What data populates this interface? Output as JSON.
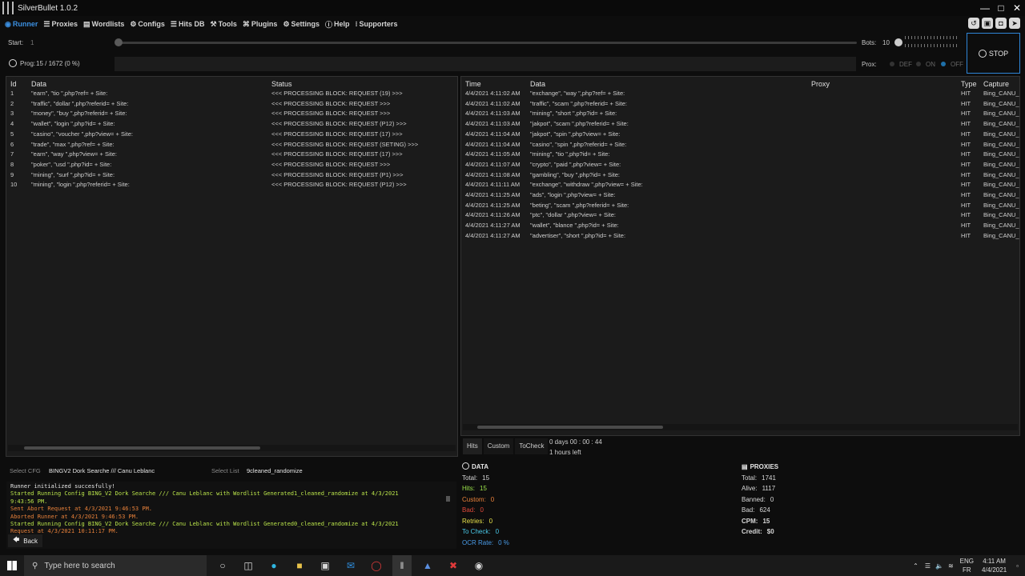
{
  "window": {
    "title": "SilverBullet 1.0.2"
  },
  "nav": {
    "items": [
      {
        "label": "Runner",
        "icon": "runner-icon",
        "active": true
      },
      {
        "label": "Proxies",
        "icon": "list-icon"
      },
      {
        "label": "Wordlists",
        "icon": "book-icon"
      },
      {
        "label": "Configs",
        "icon": "gear-icon"
      },
      {
        "label": "Hits DB",
        "icon": "database-icon"
      },
      {
        "label": "Tools",
        "icon": "tools-icon"
      },
      {
        "label": "Plugins",
        "icon": "plug-icon"
      },
      {
        "label": "Settings",
        "icon": "settings-icon"
      },
      {
        "label": "Help",
        "icon": "help-icon"
      },
      {
        "label": "Supporters",
        "icon": "more-icon"
      }
    ]
  },
  "runner": {
    "start_label": "Start:",
    "start_value": "1",
    "bots_label": "Bots:",
    "bots_value": "10",
    "prog_label": "Prog:",
    "prog_value": "15 / 1672 (0 %)",
    "prox_label": "Prox:",
    "prox_def": "DEF",
    "prox_on": "ON",
    "prox_off": "OFF",
    "stop_label": "STOP"
  },
  "left_table": {
    "headers": [
      "Id",
      "Data",
      "Status"
    ],
    "rows": [
      [
        "1",
        "\"earn\", \"tio \",php?ref= + Site:",
        "<<< PROCESSING BLOCK: REQUEST (19) >>>"
      ],
      [
        "2",
        "\"traffic\", \"dollar \",php?referid= + Site:",
        "<<< PROCESSING BLOCK: REQUEST >>>"
      ],
      [
        "3",
        "\"money\", \"buy \",php?referid= + Site:",
        "<<< PROCESSING BLOCK: REQUEST >>>"
      ],
      [
        "4",
        "\"wallet\", \"login \",php?id= + Site:",
        "<<< PROCESSING BLOCK: REQUEST (P12) >>>"
      ],
      [
        "5",
        "\"casino\", \"voucher \",php?view= + Site:",
        "<<< PROCESSING BLOCK: REQUEST (17) >>>"
      ],
      [
        "6",
        "\"trade\", \"max \",php?ref= + Site:",
        "<<< PROCESSING BLOCK: REQUEST (SETING) >>>"
      ],
      [
        "7",
        "\"earn\", \"way \",php?view= + Site:",
        "<<< PROCESSING BLOCK: REQUEST (17) >>>"
      ],
      [
        "8",
        "\"poker\", \"usd \",php?id= + Site:",
        "<<< PROCESSING BLOCK: REQUEST >>>"
      ],
      [
        "9",
        "\"mining\", \"surf \",php?id= + Site:",
        "<<< PROCESSING BLOCK: REQUEST (P1) >>>"
      ],
      [
        "10",
        "\"mining\", \"login \",php?referid= + Site:",
        "<<< PROCESSING BLOCK: REQUEST (P12) >>>"
      ]
    ]
  },
  "right_table": {
    "headers": [
      "Time",
      "Data",
      "Proxy",
      "Type",
      "Capture"
    ],
    "rows": [
      [
        "4/4/2021 4:11:02 AM",
        "\"exchange\", \"way \",php?ref= + Site:",
        "",
        "HIT",
        "Bing_CANU_"
      ],
      [
        "4/4/2021 4:11:02 AM",
        "\"traffic\", \"scam \",php?referid= + Site:",
        "",
        "HIT",
        "Bing_CANU_"
      ],
      [
        "4/4/2021 4:11:03 AM",
        "\"mining\", \"short \",php?id= + Site:",
        "",
        "HIT",
        "Bing_CANU_"
      ],
      [
        "4/4/2021 4:11:03 AM",
        "\"jakpot\", \"scam \",php?referid= + Site:",
        "",
        "HIT",
        "Bing_CANU_"
      ],
      [
        "4/4/2021 4:11:04 AM",
        "\"jakpot\", \"spin \",php?view= + Site:",
        "",
        "HIT",
        "Bing_CANU_"
      ],
      [
        "4/4/2021 4:11:04 AM",
        "\"casino\", \"spin \",php?referid= + Site:",
        "",
        "HIT",
        "Bing_CANU_"
      ],
      [
        "4/4/2021 4:11:05 AM",
        "\"mining\", \"tio \",php?id= + Site:",
        "",
        "HIT",
        "Bing_CANU_"
      ],
      [
        "4/4/2021 4:11:07 AM",
        "\"crypto\", \"paid \",php?view= + Site:",
        "",
        "HIT",
        "Bing_CANU_"
      ],
      [
        "4/4/2021 4:11:08 AM",
        "\"gambling\", \"buy \",php?id= + Site:",
        "",
        "HIT",
        "Bing_CANU_"
      ],
      [
        "4/4/2021 4:11:11 AM",
        "\"exchange\", \"withdraw \",php?view= + Site:",
        "",
        "HIT",
        "Bing_CANU_"
      ],
      [
        "4/4/2021 4:11:25 AM",
        "\"ads\", \"login \",php?view= + Site:",
        "",
        "HIT",
        "Bing_CANU_"
      ],
      [
        "4/4/2021 4:11:25 AM",
        "\"beting\", \"scam \",php?referid= + Site:",
        "",
        "HIT",
        "Bing_CANU_"
      ],
      [
        "4/4/2021 4:11:26 AM",
        "\"ptc\", \"dollar \",php?view= + Site:",
        "",
        "HIT",
        "Bing_CANU_"
      ],
      [
        "4/4/2021 4:11:27 AM",
        "\"wallet\", \"blance \",php?id= + Site:",
        "",
        "HIT",
        "Bing_CANU_"
      ],
      [
        "4/4/2021 4:11:27 AM",
        "\"advertiser\", \"short \",php?id= + Site:",
        "",
        "HIT",
        "Bing_CANU_"
      ]
    ]
  },
  "hit_tabs": [
    "Hits",
    "Custom",
    "ToCheck"
  ],
  "timer": {
    "elapsed": "0  days  00 : 00 : 44",
    "left": "1 hours left"
  },
  "select": {
    "cfg_label": "Select CFG",
    "cfg_value": "BINGV2 Dork Searche /// Canu Leblanc",
    "list_label": "Select List",
    "list_value": "9cleaned_randomize"
  },
  "log": [
    {
      "text": "Runner initialized succesfully!",
      "color": "#e8e8e8"
    },
    {
      "text": "Started Running Config BING_V2 Dork Searche /// Canu Leblanc with Wordlist Generated1_cleaned_randomize at 4/3/2021",
      "color": "#b9e34a"
    },
    {
      "text": "9:43:56 PM.",
      "color": "#b9e34a"
    },
    {
      "text": "Sent Abort Request at 4/3/2021 9:46:53 PM.",
      "color": "#e8813a"
    },
    {
      "text": "Aborted Runner at 4/3/2021 9:46:53 PM.",
      "color": "#e8813a"
    },
    {
      "text": "Started Running Config BING_V2 Dork Searche /// Canu Leblanc with Wordlist Generated0_cleaned_randomize at 4/3/2021",
      "color": "#b9e34a"
    },
    {
      "text": "             Request at 4/3/2021 10:11:17 PM.",
      "color": "#e8813a"
    }
  ],
  "back_label": "Back",
  "data_stats": {
    "title": "DATA",
    "items": [
      {
        "label": "Total:",
        "value": "15",
        "color": "#d8d8d8"
      },
      {
        "label": "Hits:",
        "value": "15",
        "color": "#9be34a"
      },
      {
        "label": "Custom:",
        "value": "0",
        "color": "#e8813a"
      },
      {
        "label": "Bad:",
        "value": "0",
        "color": "#e04a3a"
      },
      {
        "label": "Retries:",
        "value": "0",
        "color": "#e6e04a"
      },
      {
        "label": "To Check:",
        "value": "0",
        "color": "#4ac8e8"
      },
      {
        "label": "OCR Rate:",
        "value": "0 %",
        "color": "#4a9ce8"
      }
    ]
  },
  "proxy_stats": {
    "title": "PROXIES",
    "items": [
      {
        "label": "Total:",
        "value": "1741"
      },
      {
        "label": "Alive:",
        "value": "1117"
      },
      {
        "label": "Banned:",
        "value": "0"
      },
      {
        "label": "Bad:",
        "value": "624"
      },
      {
        "label": "CPM:",
        "value": "15"
      },
      {
        "label": "Credit:",
        "value": "$0"
      }
    ]
  },
  "taskbar": {
    "search_placeholder": "Type here to search",
    "lang1": "ENG",
    "lang2": "FR",
    "time": "4:11 AM",
    "date": "4/4/2021"
  }
}
